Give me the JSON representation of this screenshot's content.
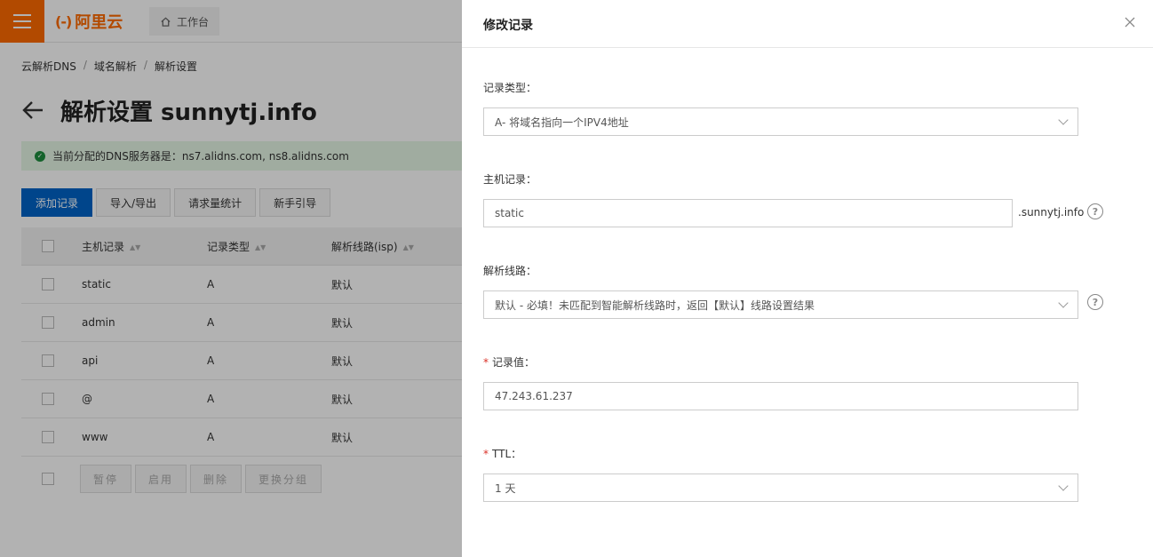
{
  "topbar": {
    "logo_text": "阿里云",
    "workbench_label": "工作台",
    "brand_color": "#ff6a00"
  },
  "breadcrumb": [
    "云解析DNS",
    "域名解析",
    "解析设置"
  ],
  "page": {
    "title": "解析设置 sunnytj.info",
    "dns_notice": "当前分配的DNS服务器是：ns7.alidns.com, ns8.alidns.com"
  },
  "toolbar": {
    "add_record": "添加记录",
    "import_export": "导入/导出",
    "request_stats": "请求量统计",
    "beginner_guide": "新手引导"
  },
  "table": {
    "headers": [
      "主机记录",
      "记录类型",
      "解析线路(isp)"
    ],
    "rows": [
      {
        "host": "static",
        "type": "A",
        "line": "默认"
      },
      {
        "host": "admin",
        "type": "A",
        "line": "默认"
      },
      {
        "host": "api",
        "type": "A",
        "line": "默认"
      },
      {
        "host": "@",
        "type": "A",
        "line": "默认"
      },
      {
        "host": "www",
        "type": "A",
        "line": "默认"
      }
    ],
    "footer_actions": [
      "暂停",
      "启用",
      "删除",
      "更换分组"
    ]
  },
  "drawer": {
    "title": "修改记录",
    "record_type_label": "记录类型：",
    "record_type_value": "A- 将域名指向一个IPV4地址",
    "host_label": "主机记录：",
    "host_value": "static",
    "host_suffix": ".sunnytj.info",
    "line_label": "解析线路：",
    "line_value": "默认 - 必填！未匹配到智能解析线路时，返回【默认】线路设置结果",
    "value_label": "记录值：",
    "value_value": "47.243.61.237",
    "ttl_label": "TTL：",
    "ttl_value": "1 天"
  }
}
